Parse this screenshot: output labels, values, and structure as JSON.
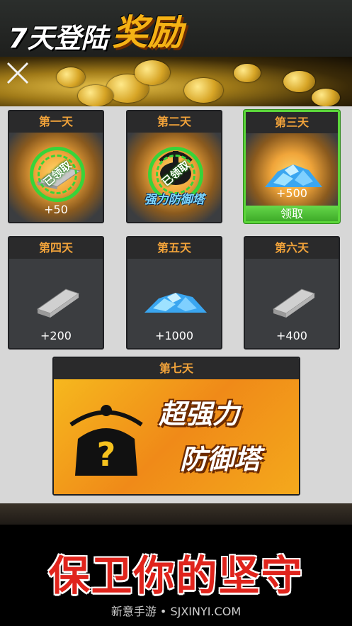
{
  "title": {
    "part1": "7天登陆",
    "part2": "奖励"
  },
  "days": [
    {
      "label": "第一天",
      "amount": "+50",
      "reward_icon": "silver-ingot-icon",
      "status_stamp": "已领取"
    },
    {
      "label": "第二天",
      "item_name": "强力防御塔",
      "reward_icon": "defense-tower-icon",
      "status_stamp": "已领取"
    },
    {
      "label": "第三天",
      "amount": "+500",
      "reward_icon": "diamond-pile-icon",
      "claim_label": "领取"
    },
    {
      "label": "第四天",
      "amount": "+200",
      "reward_icon": "silver-ingot-icon"
    },
    {
      "label": "第五天",
      "amount": "+1000",
      "reward_icon": "diamond-pile-icon"
    },
    {
      "label": "第六天",
      "amount": "+400",
      "reward_icon": "silver-ingot-icon"
    }
  ],
  "day7": {
    "label": "第七天",
    "line1": "超强力",
    "line2": "防御塔",
    "reward_icon": "mystery-tower-icon"
  },
  "slogan": "保卫你的坚守",
  "watermark": "新意手游 • SJXINYI.COM",
  "colors": {
    "accent": "#f0a23a",
    "claimed_green": "#37d43a",
    "slogan_red": "#e0241c"
  }
}
